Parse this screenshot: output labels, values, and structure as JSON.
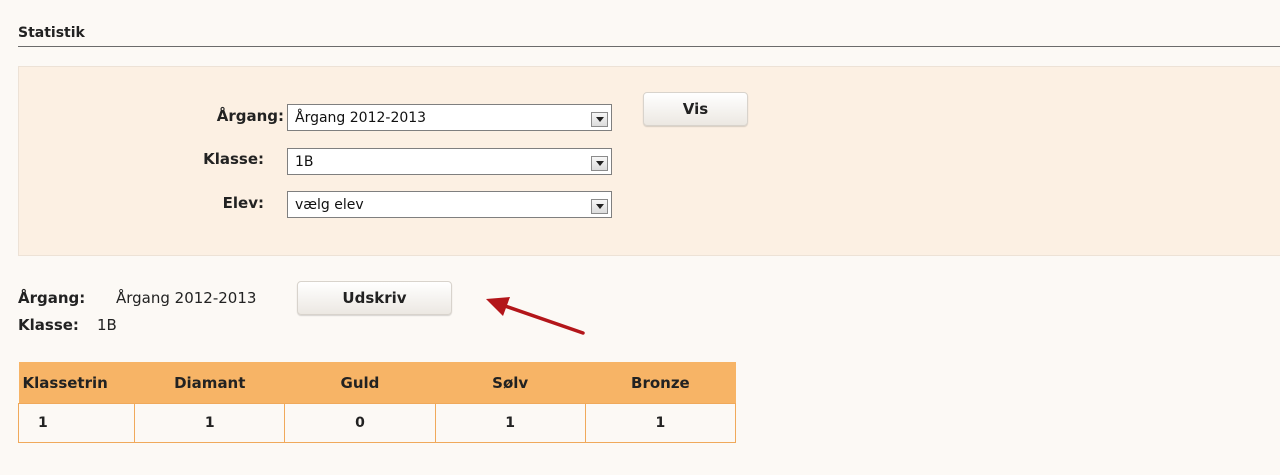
{
  "page": {
    "title": "Statistik"
  },
  "filters": {
    "argang_label": "Årgang:",
    "argang_value": "Årgang 2012-2013",
    "klasse_label": "Klasse:",
    "klasse_value": "1B",
    "elev_label": "Elev:",
    "elev_value": "vælg elev",
    "vis_button": "Vis"
  },
  "summary": {
    "argang_label": "Årgang:",
    "argang_value": "Årgang 2012-2013",
    "klasse_label": "Klasse:",
    "klasse_value": "1B",
    "print_button": "Udskriv"
  },
  "table": {
    "headers": [
      "Klassetrin",
      "Diamant",
      "Guld",
      "Sølv",
      "Bronze"
    ],
    "rows": [
      [
        "1",
        "1",
        "0",
        "1",
        "1"
      ]
    ]
  },
  "colors": {
    "panel_bg": "#fcf0e3",
    "table_header_bg": "#f7b466",
    "annotation_arrow": "#b3161a"
  }
}
